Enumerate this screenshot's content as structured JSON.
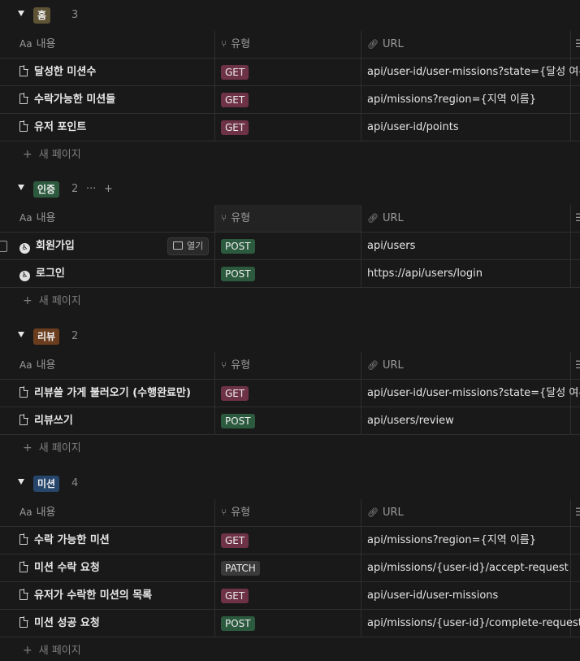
{
  "columns": {
    "name_icon": "Aa",
    "name": "내용",
    "type": "유형",
    "url": "URL",
    "more": "☰"
  },
  "new_page": "새 페이지",
  "open_label": "열기",
  "colors": {
    "GET": "#6e3246",
    "POST": "#2b5a3e",
    "PATCH": "#3a3a3a"
  },
  "groups": [
    {
      "label": "홈",
      "count": "3",
      "tag_color": "#5f5336",
      "rows": [
        {
          "icon": "doc-icon",
          "name": "달성한 미션수",
          "method": "GET",
          "url": "api/user-id/user-missions?state={달성 여부}"
        },
        {
          "icon": "doc-icon",
          "name": "수락가능한 미션들",
          "method": "GET",
          "url": "api/missions?region={지역 이름}"
        },
        {
          "icon": "doc-icon",
          "name": "유저 포인트",
          "method": "GET",
          "url": "api/user-id/points"
        }
      ]
    },
    {
      "label": "인증",
      "count": "2",
      "tag_color": "#2d5a3f",
      "more": "···",
      "add": "+",
      "rows": [
        {
          "icon": "person-icon",
          "name": "회원가입",
          "method": "POST",
          "url": "api/users"
        },
        {
          "icon": "person-icon",
          "name": "로그인",
          "method": "POST",
          "url": "https://api/users/login"
        }
      ]
    },
    {
      "label": "리뷰",
      "count": "2",
      "tag_color": "#6b3d1f",
      "rows": [
        {
          "icon": "doc-icon",
          "name": "리뷰쓸 가게 불러오기 (수행완료만)",
          "method": "GET",
          "url": "api/user-id/user-missions?state={달성 여부}"
        },
        {
          "icon": "doc-icon",
          "name": "리뷰쓰기",
          "method": "POST",
          "url": "api/users/review"
        }
      ]
    },
    {
      "label": "미션",
      "count": "4",
      "tag_color": "#26466b",
      "rows": [
        {
          "icon": "doc-icon",
          "name": "수락 가능한 미션",
          "method": "GET",
          "url": "api/missions?region={지역 이름}"
        },
        {
          "icon": "doc-icon",
          "name": "미션 수락 요청",
          "method": "PATCH",
          "url": "api/missions/{user-id}/accept-request"
        },
        {
          "icon": "doc-icon",
          "name": "유저가 수락한 미션의 목록",
          "method": "GET",
          "url": "api/user-id/user-missions"
        },
        {
          "icon": "doc-icon",
          "name": "미션 성공 요청",
          "method": "POST",
          "url": "api/missions/{user-id}/complete-request"
        }
      ]
    }
  ]
}
